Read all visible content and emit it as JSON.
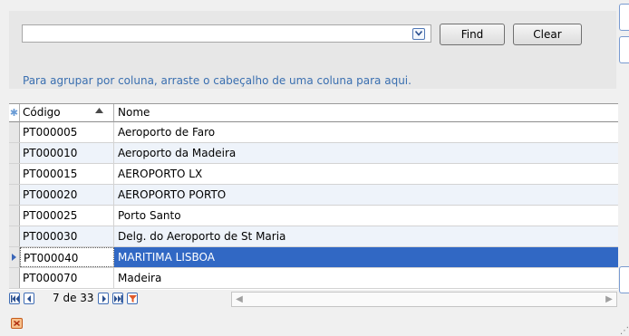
{
  "search": {
    "value": "",
    "placeholder": ""
  },
  "buttons": {
    "find": "Find",
    "clear": "Clear"
  },
  "group_hint": "Para agrupar por coluna, arraste o cabeçalho de uma coluna para aqui.",
  "grid": {
    "columns": [
      "Código",
      "Nome"
    ],
    "sorted_column": "Código",
    "sort_direction": "ascending",
    "rows": [
      {
        "code": "PT000005",
        "name": "Aeroporto de Faro"
      },
      {
        "code": "PT000010",
        "name": "Aeroporto da Madeira"
      },
      {
        "code": "PT000015",
        "name": "AEROPORTO LX"
      },
      {
        "code": "PT000020",
        "name": "AEROPORTO PORTO"
      },
      {
        "code": "PT000025",
        "name": "Porto Santo"
      },
      {
        "code": "PT000030",
        "name": "Delg. do Aeroporto de St Maria"
      },
      {
        "code": "PT000040",
        "name": "MARITIMA LISBOA"
      },
      {
        "code": "PT000070",
        "name": "Madeira"
      }
    ],
    "selected_row": "PT000040"
  },
  "navigator": {
    "position": "7 de 33"
  },
  "colors": {
    "selection": "#3168c4",
    "hint_text": "#3a6fb0",
    "alt_row": "#eef3fa"
  },
  "icons": [
    "chevron-down-icon",
    "first-page-icon",
    "prev-icon",
    "next-icon",
    "last-page-icon",
    "filter-icon",
    "close-icon",
    "sort-asc-icon",
    "row-pointer-icon"
  ]
}
